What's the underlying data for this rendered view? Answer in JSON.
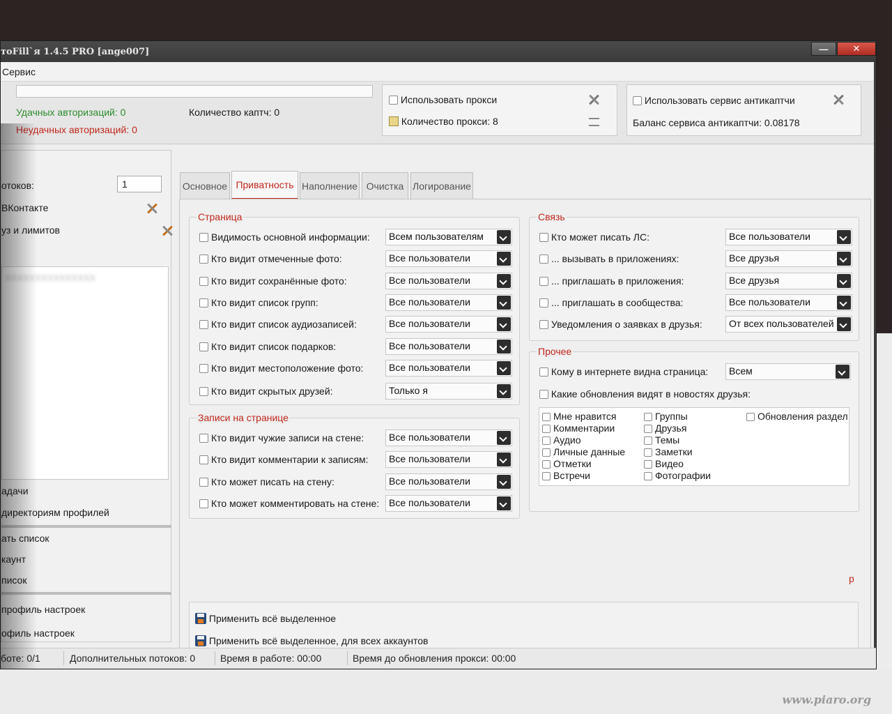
{
  "window": {
    "title": "тоFill`я 1.4.5 PRO [ange007]",
    "min_label": "—",
    "close_label": "✕"
  },
  "menu": {
    "items": [
      {
        "label": "Сервис"
      }
    ]
  },
  "stats": {
    "success_auth": "Удачных авторизаций: 0",
    "failed_auth": "Неудачных авторизаций: 0",
    "captcha_count": "Количество каптч: 0"
  },
  "proxy": {
    "use_label": "Использовать прокси",
    "count_label": "Количество прокси: 8"
  },
  "anticaptcha": {
    "use_label": "Использовать сервис антикаптчи",
    "balance_label": "Баланс сервиса антикаптчи: 0.08178"
  },
  "left_panel": {
    "threads_label": "отоков:",
    "threads_value": "1",
    "vk_label": "ВКонтакте",
    "limits_label": "уз и лимитов",
    "list_blurred": "XXXXXXXXXXXXXXX",
    "tasks_label": "адачи",
    "dirs_label": "директориям профилей",
    "list_btn": "ать список",
    "account_btn": "каунт",
    "list2_btn": "писок",
    "profile_save": "профиль настроек",
    "profile_load": "офиль настроек"
  },
  "tabs": [
    {
      "label": "Основное"
    },
    {
      "label": "Приватность"
    },
    {
      "label": "Наполнение"
    },
    {
      "label": "Очистка"
    },
    {
      "label": "Логирование"
    }
  ],
  "page_group": {
    "title": "Страница",
    "rows": [
      {
        "label": "Видимость основной информации:",
        "value": "Всем пользователям"
      },
      {
        "label": "Кто видит отмеченные фото:",
        "value": "Все пользователи"
      },
      {
        "label": "Кто видит сохранённые фото:",
        "value": "Все пользователи"
      },
      {
        "label": "Кто видит список групп:",
        "value": "Все пользователи"
      },
      {
        "label": "Кто видит список аудиозаписей:",
        "value": "Все пользователи"
      },
      {
        "label": "Кто видит список подарков:",
        "value": "Все пользователи"
      },
      {
        "label": "Кто видит местоположение фото:",
        "value": "Все пользователи"
      },
      {
        "label": "Кто видит скрытых друзей:",
        "value": "Только я"
      }
    ]
  },
  "wall_group": {
    "title": "Записи на странице",
    "rows": [
      {
        "label": "Кто видит чужие записи на стене:",
        "value": "Все пользователи"
      },
      {
        "label": "Кто видит комментарии к записям:",
        "value": "Все пользователи"
      },
      {
        "label": "Кто может писать на стену:",
        "value": "Все пользователи"
      },
      {
        "label": "Кто может комментировать на стене:",
        "value": "Все пользователи"
      }
    ]
  },
  "contact_group": {
    "title": "Связь",
    "rows": [
      {
        "label": "Кто может писать ЛС:",
        "value": "Все пользователи"
      },
      {
        "label": "... вызывать в приложениях:",
        "value": "Все друзья"
      },
      {
        "label": "... приглашать в приложения:",
        "value": "Все друзья"
      },
      {
        "label": "... приглашать в сообщества:",
        "value": "Все пользователи"
      },
      {
        "label": "Уведомления о заявках в друзья:",
        "value": "От всех пользователей"
      }
    ]
  },
  "other_group": {
    "title": "Прочее",
    "internet_label": "Кому в интернете видна страница:",
    "internet_value": "Всем",
    "news_label": "Какие обновления видят в новостях друзья:",
    "news_col1": [
      "Мне нравится",
      "Комментарии",
      "Аудио",
      "Личные данные",
      "Отметки",
      "Встречи"
    ],
    "news_col2": [
      "Группы",
      "Друзья",
      "Темы",
      "Заметки",
      "Видео",
      "Фотографии"
    ],
    "news_col3": [
      "Обновления раздел"
    ]
  },
  "stray_char": "р",
  "actions": {
    "apply_selected": "Применить всё выделенное",
    "apply_all_accounts": "Применить всё выделенное, для всех аккаунтов"
  },
  "status": {
    "work": "боте: 0/1",
    "extra_threads": "Дополнительных потоков: 0",
    "uptime": "Время в работе: 00:00",
    "proxy_refresh": "Время до обновления прокси: 00:00"
  },
  "watermark": "www.piaro.org"
}
